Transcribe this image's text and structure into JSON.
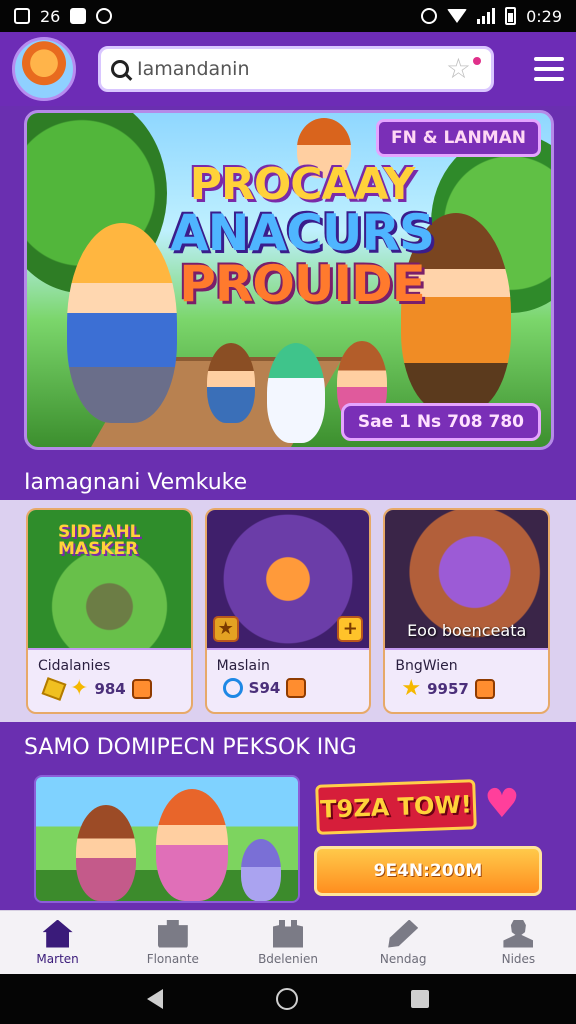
{
  "status_bar": {
    "left": "26",
    "time": "0:29"
  },
  "header": {
    "search": {
      "value": "Iamandanin"
    }
  },
  "hero": {
    "title_line1": "PROCAAY",
    "title_line2": "ANACURS",
    "title_line3": "PROUIDE",
    "tag": "FN & LANMAN",
    "button": "Sae 1 Ns 708 780"
  },
  "section1": {
    "title": "Iamagnani Vemkuke",
    "cards": [
      {
        "logo": "SIDEAHL MASKER",
        "caption": "",
        "name": "Cidalanies",
        "stat": "984"
      },
      {
        "logo": "",
        "caption": "",
        "name": "Maslain",
        "stat": "S94"
      },
      {
        "logo": "",
        "caption": "Eoo boenceata",
        "name": "BngWien",
        "stat": "9957"
      }
    ]
  },
  "section2": {
    "title": "SAMO DOMIPECN PEKSOK ING",
    "promo_banner": "T9ZA TOW!",
    "promo_button": "9E4N:200M"
  },
  "bottom_nav": {
    "items": [
      {
        "label": "Marten",
        "icon": "home-icon"
      },
      {
        "label": "Flonante",
        "icon": "store-icon"
      },
      {
        "label": "Bdelenien",
        "icon": "bag-icon"
      },
      {
        "label": "Nendag",
        "icon": "pen-icon"
      },
      {
        "label": "Nides",
        "icon": "user-icon"
      }
    ]
  },
  "colors": {
    "brand_purple": "#6d2cb6",
    "accent_orange": "#ff8e1f",
    "banner_red": "#d61e3a"
  }
}
